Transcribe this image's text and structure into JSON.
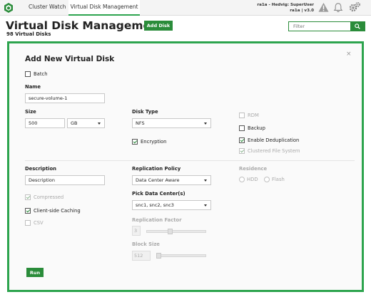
{
  "nav": {
    "tabs": [
      "Cluster Watch",
      "Virtual Disk Management"
    ],
    "user_line1": "ra1a - Hedvig: SuperUser",
    "user_line2": "ra1a | v3.0"
  },
  "header": {
    "title": "Virtual Disk Management",
    "subtitle": "98 Virtual Disks",
    "add_disk_label": "Add Disk",
    "filter_placeholder": "Filter"
  },
  "modal": {
    "title": "Add New Virtual Disk",
    "batch_label": "Batch",
    "name_label": "Name",
    "name_value": "secure-volume-1",
    "size_label": "Size",
    "size_value": "500",
    "size_unit": "GB",
    "disk_type_label": "Disk Type",
    "disk_type_value": "NFS",
    "encryption_label": "Encryption",
    "rdm_label": "RDM",
    "backup_label": "Backup",
    "dedup_label": "Enable Deduplication",
    "clustered_fs_label": "Clustered File System",
    "description_label": "Description",
    "description_placeholder": "Description",
    "compressed_label": "Compressed",
    "client_cache_label": "Client-side Caching",
    "csv_label": "CSV",
    "replication_policy_label": "Replication Policy",
    "replication_policy_value": "Data Center Aware",
    "pick_dc_label": "Pick Data Center(s)",
    "pick_dc_value": "snc1, snc2, snc3",
    "replication_factor_label": "Replication Factor",
    "replication_factor_value": "3",
    "block_size_label": "Block Size",
    "block_size_value": "512",
    "residence_label": "Residence",
    "hdd_label": "HDD",
    "flash_label": "Flash",
    "run_label": "Run",
    "close_glyph": "×"
  },
  "state": {
    "batch": false,
    "encryption": true,
    "rdm": false,
    "backup": false,
    "dedup": true,
    "clustered_fs": true,
    "compressed": true,
    "client_cache": true,
    "csv": false
  },
  "colors": {
    "accent": "#2a8c3a",
    "modal_border": "#2da44e"
  }
}
